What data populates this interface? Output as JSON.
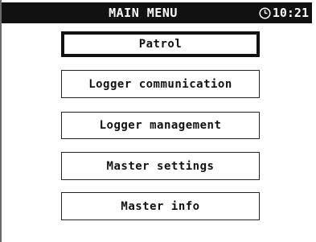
{
  "header": {
    "title": "MAIN MENU",
    "time": "10:21",
    "clock_icon": "clock-icon"
  },
  "menu": {
    "selected_index": 0,
    "items": [
      {
        "label": "Patrol"
      },
      {
        "label": "Logger communication"
      },
      {
        "label": "Logger management"
      },
      {
        "label": "Master settings"
      },
      {
        "label": "Master info"
      }
    ]
  },
  "colors": {
    "header_bg": "#111111",
    "header_fg": "#ffffff",
    "background": "#ffffff",
    "border": "#111111"
  }
}
